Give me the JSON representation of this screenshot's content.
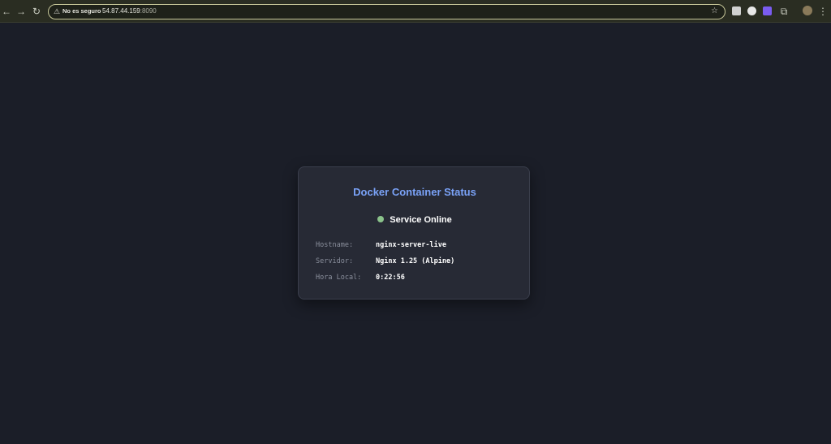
{
  "browser": {
    "security_label": "No es seguro",
    "url_host": "54.87.44.159",
    "url_port": ":8090"
  },
  "card": {
    "title": "Docker Container Status",
    "status": "Service Online",
    "status_color": "#8bc38b",
    "rows": [
      {
        "label": "Hostname:",
        "value": "nginx-server-live"
      },
      {
        "label": "Servidor:",
        "value": "Nginx 1.25 (Alpine)"
      },
      {
        "label": "Hora Local:",
        "value": "0:22:56"
      }
    ]
  }
}
